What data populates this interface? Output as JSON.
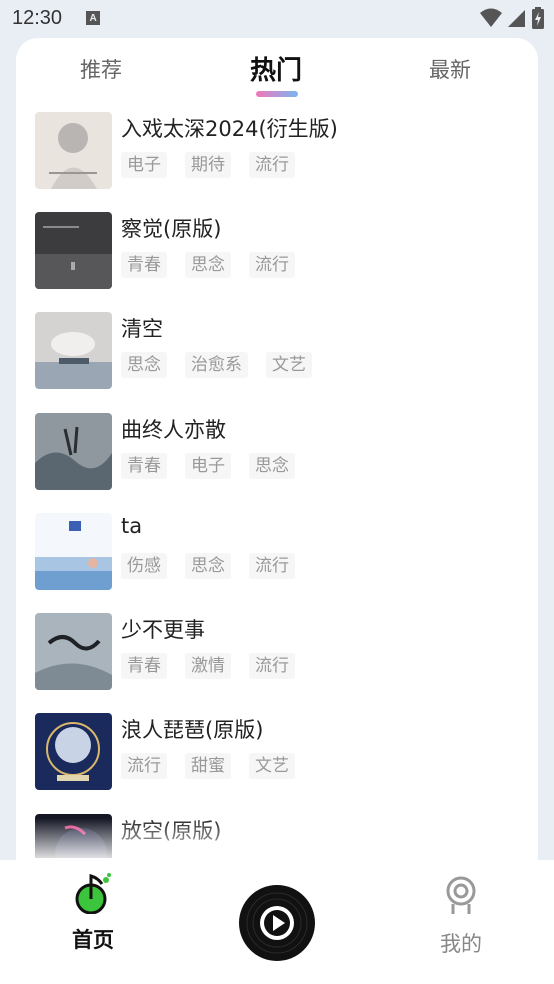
{
  "status_bar": {
    "time": "12:30",
    "notification_letter": "A"
  },
  "tabs": [
    {
      "label": "推荐",
      "active": false
    },
    {
      "label": "热门",
      "active": true
    },
    {
      "label": "最新",
      "active": false
    }
  ],
  "songs": [
    {
      "title": "入戏太深2024(衍生版)",
      "tags": [
        "电子",
        "期待",
        "流行"
      ]
    },
    {
      "title": "察觉(原版)",
      "tags": [
        "青春",
        "思念",
        "流行"
      ]
    },
    {
      "title": "清空",
      "tags": [
        "思念",
        "治愈系",
        "文艺"
      ]
    },
    {
      "title": "曲终人亦散",
      "tags": [
        "青春",
        "电子",
        "思念"
      ]
    },
    {
      "title": "ta",
      "tags": [
        "伤感",
        "思念",
        "流行"
      ]
    },
    {
      "title": "少不更事",
      "tags": [
        "青春",
        "激情",
        "流行"
      ]
    },
    {
      "title": "浪人琵琶(原版)",
      "tags": [
        "流行",
        "甜蜜",
        "文艺"
      ]
    },
    {
      "title": "放空(原版)",
      "tags": [
        "",
        "",
        ""
      ]
    }
  ],
  "nav": {
    "home_label": "首页",
    "mine_label": "我的",
    "home_icon": "music-note-icon",
    "play_icon": "play-icon",
    "mine_icon": "person-icon"
  },
  "colors": {
    "background": "#e8eef3",
    "accent_green": "#3cc43c",
    "tab_gradient_start": "#f277b8",
    "tab_gradient_end": "#79b6f2"
  }
}
